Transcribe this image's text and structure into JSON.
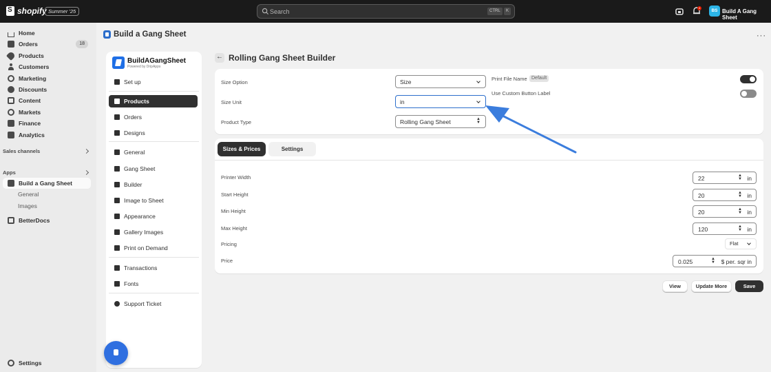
{
  "topbar": {
    "brand": "shopify",
    "edition": "Summer '25",
    "search_placeholder": "Search",
    "kbd_ctrl": "CTRL",
    "kbd_k": "K",
    "notification_count": "4",
    "avatar_initials": "BS",
    "store_name": "Build A Gang Sheet"
  },
  "nav": {
    "items": [
      {
        "label": "Home",
        "icon": "home-icon"
      },
      {
        "label": "Orders",
        "icon": "orders-icon",
        "badge": "18"
      },
      {
        "label": "Products",
        "icon": "products-icon"
      },
      {
        "label": "Customers",
        "icon": "customers-icon"
      },
      {
        "label": "Marketing",
        "icon": "marketing-icon"
      },
      {
        "label": "Discounts",
        "icon": "discounts-icon"
      },
      {
        "label": "Content",
        "icon": "content-icon"
      },
      {
        "label": "Markets",
        "icon": "markets-icon"
      },
      {
        "label": "Finance",
        "icon": "finance-icon"
      },
      {
        "label": "Analytics",
        "icon": "analytics-icon"
      }
    ],
    "sales_channels": "Sales channels",
    "apps": "Apps",
    "app_items": [
      {
        "label": "Build a Gang Sheet"
      },
      {
        "label": "General"
      },
      {
        "label": "Images"
      },
      {
        "label": "BetterDocs"
      }
    ],
    "settings": "Settings"
  },
  "page": {
    "title": "Build a Gang Sheet",
    "more": "···"
  },
  "app_sidebar": {
    "brand_title": "BuildAGangSheet",
    "brand_sub": "Powered by DripApps",
    "items": [
      {
        "label": "Set up"
      },
      {
        "label": "Products"
      },
      {
        "label": "Orders"
      },
      {
        "label": "Designs"
      },
      {
        "label": "General"
      },
      {
        "label": "Gang Sheet"
      },
      {
        "label": "Builder"
      },
      {
        "label": "Image to Sheet"
      },
      {
        "label": "Appearance"
      },
      {
        "label": "Gallery Images"
      },
      {
        "label": "Print on Demand"
      },
      {
        "label": "Transactions"
      },
      {
        "label": "Fonts"
      },
      {
        "label": "Support Ticket"
      }
    ]
  },
  "main": {
    "title": "Rolling Gang Sheet Builder",
    "options": {
      "size_option_label": "Size Option",
      "size_option_value": "Size",
      "size_unit_label": "Size Unit",
      "size_unit_value": "in",
      "product_type_label": "Product Type",
      "product_type_value": "Rolling Gang Sheet",
      "print_file_name_label": "Print File Name",
      "print_file_name_badge": "Default",
      "custom_button_label": "Use Custom Button Label",
      "print_file_name_on": true,
      "custom_button_on": false
    },
    "tabs": [
      {
        "label": "Sizes & Prices",
        "active": true
      },
      {
        "label": "Settings",
        "active": false
      }
    ],
    "sizes": {
      "printer_width_label": "Printer Width",
      "printer_width_value": "22",
      "start_height_label": "Start Height",
      "start_height_value": "20",
      "min_height_label": "Min Height",
      "min_height_value": "20",
      "max_height_label": "Max Height",
      "max_height_value": "120",
      "unit": "in",
      "pricing_label": "Pricing",
      "pricing_value": "Flat",
      "price_label": "Price",
      "price_value": "0.025",
      "price_unit": "$ per. sqr in"
    },
    "buttons": {
      "view": "View",
      "update_more": "Update More",
      "save": "Save"
    }
  },
  "colors": {
    "topbar": "#1a1a1a",
    "accent": "#2c6ecb",
    "arrow": "#3b7ddd"
  }
}
